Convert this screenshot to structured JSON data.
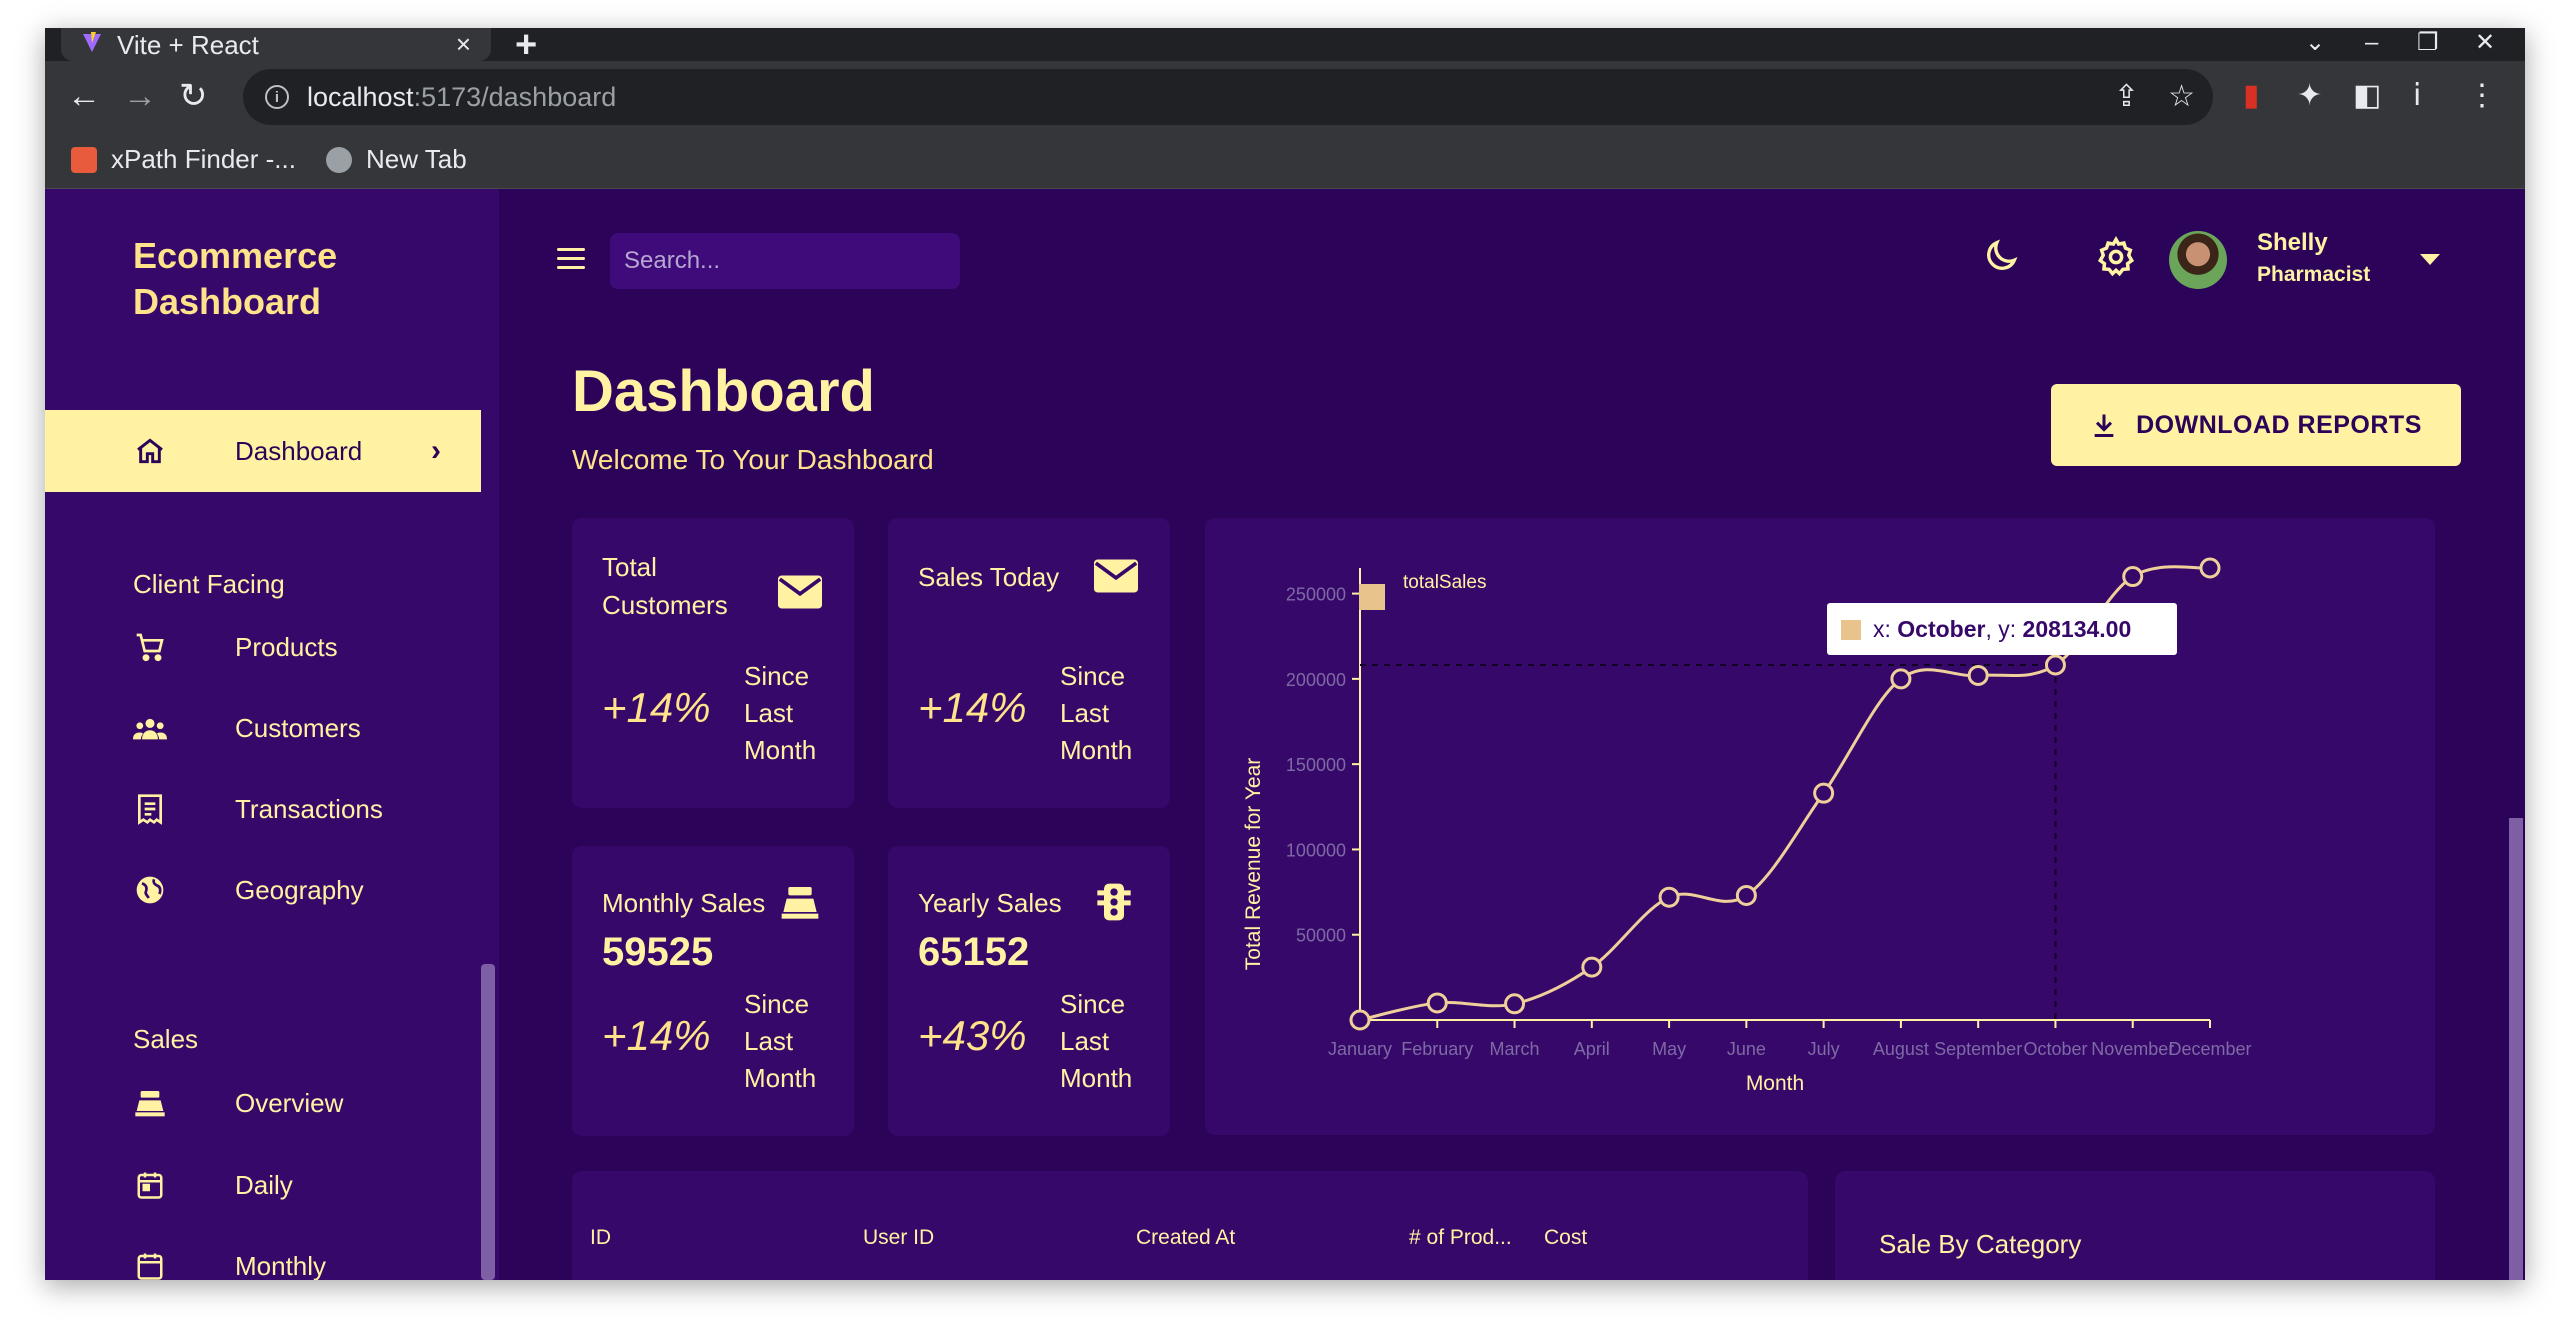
{
  "browser": {
    "tab_title": "Vite + React",
    "tab_close": "×",
    "new_tab": "+",
    "url_host": "localhost",
    "url_path": ":5173/dashboard",
    "bookmarks": [
      "xPath Finder -...",
      "New Tab"
    ]
  },
  "sidebar": {
    "brand_line1": "Ecommerce",
    "brand_line2": "Dashboard",
    "active_item": "Dashboard",
    "section_client": "Client Facing",
    "client_items": [
      "Products",
      "Customers",
      "Transactions",
      "Geography"
    ],
    "section_sales": "Sales",
    "sales_items": [
      "Overview",
      "Daily",
      "Monthly"
    ]
  },
  "topbar": {
    "search_placeholder": "Search...",
    "user_name": "Shelly",
    "user_role": "Pharmacist"
  },
  "header": {
    "title": "Dashboard",
    "subtitle": "Welcome To Your Dashboard",
    "download_label": "DOWNLOAD REPORTS"
  },
  "stats": [
    {
      "title_l1": "Total",
      "title_l2": "Customers",
      "value": "",
      "pct": "+14%",
      "since": [
        "Since",
        "Last",
        "Month"
      ],
      "icon": "mail-icon"
    },
    {
      "title_l1": "Sales Today",
      "title_l2": "",
      "value": "",
      "pct": "+14%",
      "since": [
        "Since",
        "Last",
        "Month"
      ],
      "icon": "mail-icon"
    },
    {
      "title_l1": "Monthly Sales",
      "title_l2": "",
      "value": "59525",
      "pct": "+14%",
      "since": [
        "Since",
        "Last",
        "Month"
      ],
      "icon": "register-icon"
    },
    {
      "title_l1": "Yearly Sales",
      "title_l2": "",
      "value": "65152",
      "pct": "+43%",
      "since": [
        "Since",
        "Last",
        "Month"
      ],
      "icon": "traffic-icon"
    }
  ],
  "chart_data": {
    "type": "line",
    "legend": "totalSales",
    "xlabel": "Month",
    "ylabel": "Total Revenue for Year",
    "categories": [
      "January",
      "February",
      "March",
      "April",
      "May",
      "June",
      "July",
      "August",
      "September",
      "October",
      "November",
      "December"
    ],
    "series": [
      {
        "name": "totalSales",
        "values": [
          0,
          10000,
          9500,
          31000,
          72000,
          73000,
          133000,
          200000,
          202000,
          208134,
          260000,
          265000
        ]
      }
    ],
    "ylim": [
      0,
      265000
    ],
    "yticks": [
      50000,
      100000,
      150000,
      200000,
      250000
    ],
    "tooltip": {
      "x_label": "x: ",
      "x_value": "October",
      "y_label": ", y: ",
      "y_value": "208134.00",
      "index": 9
    },
    "colors": {
      "line": "#f0d09a",
      "axis": "#fff3a3",
      "tick": "#7e6aa5"
    }
  },
  "table": {
    "headers": [
      "ID",
      "User ID",
      "Created At",
      "# of Prod...",
      "Cost"
    ]
  },
  "category": {
    "title": "Sale By Category"
  }
}
